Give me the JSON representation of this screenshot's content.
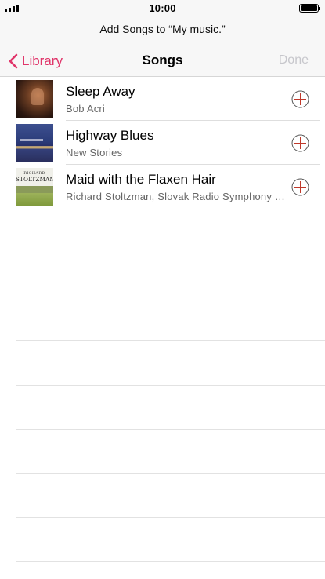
{
  "status_bar": {
    "time": "10:00"
  },
  "prompt": "Add Songs to “My music.”",
  "nav": {
    "back_label": "Library",
    "title": "Songs",
    "done_label": "Done"
  },
  "songs": [
    {
      "title": "Sleep Away",
      "artist": "Bob Acri"
    },
    {
      "title": "Highway Blues",
      "artist": "New Stories"
    },
    {
      "title": "Maid with the Flaxen Hair",
      "artist": "Richard Stoltzman, Slovak Radio Symphony Orchestra"
    }
  ],
  "album_art": {
    "richard_text_1": "RICHARD",
    "richard_text_2": "STOLTZMAN"
  },
  "colors": {
    "accent": "#e0356a",
    "done_disabled": "#c7c7cc",
    "add_icon": "#555555"
  }
}
